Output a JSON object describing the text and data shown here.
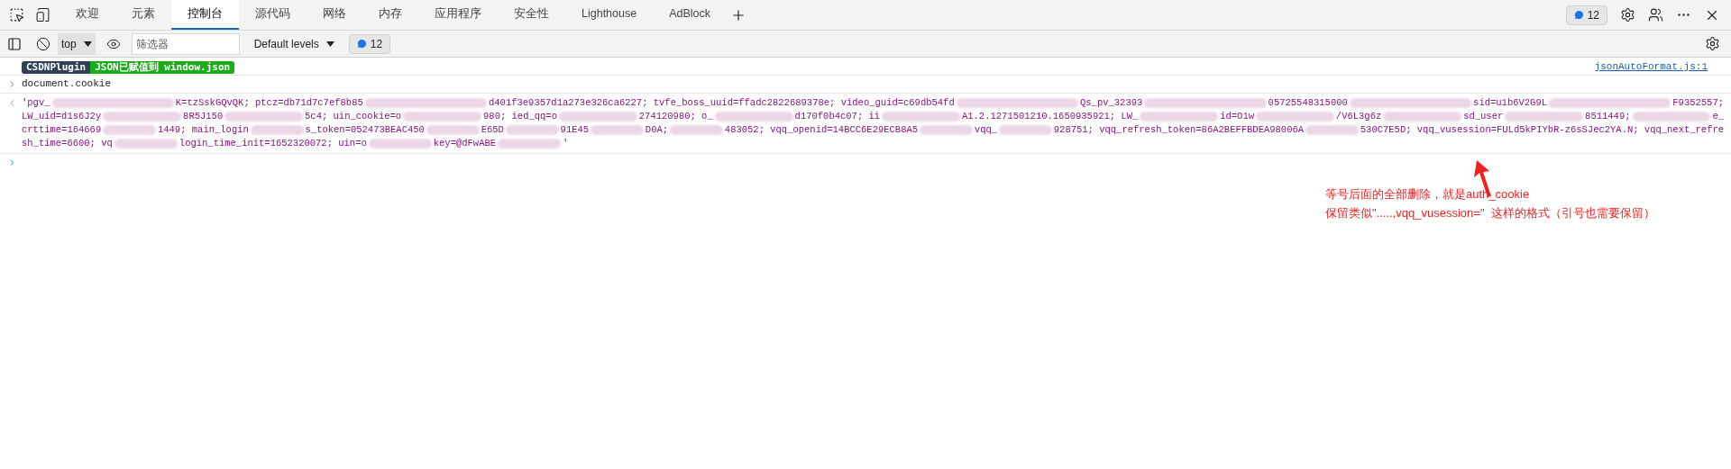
{
  "tabs": [
    {
      "label": "欢迎",
      "selected": false
    },
    {
      "label": "元素",
      "selected": false
    },
    {
      "label": "控制台",
      "selected": true
    },
    {
      "label": "源代码",
      "selected": false
    },
    {
      "label": "网络",
      "selected": false
    },
    {
      "label": "内存",
      "selected": false
    },
    {
      "label": "应用程序",
      "selected": false
    },
    {
      "label": "安全性",
      "selected": false
    },
    {
      "label": "Lighthouse",
      "selected": false
    },
    {
      "label": "AdBlock",
      "selected": false
    }
  ],
  "issues_badge": {
    "count": "12"
  },
  "toolbar": {
    "context": "top",
    "filter": {
      "placeholder": "筛选器"
    },
    "levels": "Default levels",
    "messages_badge": "12"
  },
  "log": {
    "badges": [
      {
        "text": "CSDNPlugin",
        "color": "#2f4058"
      },
      {
        "text": "JSON已赋值到 window.json",
        "color": "#1aac19"
      }
    ],
    "source": "jsonAutoFormat.js:1"
  },
  "input": {
    "text": "document.cookie"
  },
  "output": {
    "lines": [
      [
        {
          "kind": "text",
          "text": "'pgv_"
        },
        {
          "kind": "blur"
        },
        {
          "kind": "text",
          "text": "K=tzSskGQvQK; ptcz=db71d7c7ef8b85"
        },
        {
          "kind": "blur"
        },
        {
          "kind": "text",
          "text": "d401f3e9357d1a273e326ca6227; tvfe_boss_uuid=ffadc2822689378e; video_guid=c69db54fd"
        },
        {
          "kind": "blur"
        },
        {
          "kind": "text",
          "text": "Qs_pv_32393"
        },
        {
          "kind": "blur"
        },
        {
          "kind": "text",
          "text": "05725548315000"
        },
        {
          "kind": "blur"
        },
        {
          "kind": "text",
          "text": "sid=u1b6V2G9L"
        },
        {
          "kind": "blur"
        },
        {
          "kind": "text",
          "text": "F9352557;"
        }
      ],
      [
        {
          "kind": "text",
          "text": "LW_uid=d1s6J2y"
        },
        {
          "kind": "blur"
        },
        {
          "kind": "text",
          "text": "8R5J150"
        },
        {
          "kind": "blur"
        },
        {
          "kind": "text",
          "text": "5c4; uin_cookie=o"
        },
        {
          "kind": "blur"
        },
        {
          "kind": "text",
          "text": "980; ied_qq=o"
        },
        {
          "kind": "blur"
        },
        {
          "kind": "text",
          "text": "274120980; o_"
        },
        {
          "kind": "blur"
        },
        {
          "kind": "text",
          "text": "d170f0b4c07; ii"
        },
        {
          "kind": "blur"
        },
        {
          "kind": "text",
          "text": "A1.2.1271501210.1650935921; LW_"
        },
        {
          "kind": "blur"
        },
        {
          "kind": "text",
          "text": "id=O1w"
        },
        {
          "kind": "blur"
        },
        {
          "kind": "text",
          "text": "/V6L3g6z"
        },
        {
          "kind": "blur"
        },
        {
          "kind": "text",
          "text": "sd_user"
        },
        {
          "kind": "blur"
        },
        {
          "kind": "text",
          "text": "8511449;"
        },
        {
          "kind": "blur"
        },
        {
          "kind": "text",
          "text": "e_"
        }
      ],
      [
        {
          "kind": "text",
          "text": "crttime=164669"
        },
        {
          "kind": "blur"
        },
        {
          "kind": "text",
          "text": "1449; main_login"
        },
        {
          "kind": "blur"
        },
        {
          "kind": "text",
          "text": "s_token=052473BEAC450"
        },
        {
          "kind": "blur"
        },
        {
          "kind": "text",
          "text": "E65D"
        },
        {
          "kind": "blur"
        },
        {
          "kind": "text",
          "text": "91E45"
        },
        {
          "kind": "blur"
        },
        {
          "kind": "text",
          "text": "D0A;"
        },
        {
          "kind": "blur"
        },
        {
          "kind": "text",
          "text": "483052; vqq_openid=14BCC6E29ECB8A5"
        },
        {
          "kind": "blur"
        },
        {
          "kind": "text",
          "text": "vqq_"
        },
        {
          "kind": "blur"
        },
        {
          "kind": "text",
          "text": "928751; vqq_refresh_token=86A2BEFFBDEA98006A"
        },
        {
          "kind": "blur"
        },
        {
          "kind": "text",
          "text": "530C7E5D; vqq_vusession=FULd5kPIYbR-z6sSJec2YA.N; vqq_next_refre"
        }
      ],
      [
        {
          "kind": "text",
          "text": "sh_time=6600; vq"
        },
        {
          "kind": "blur"
        },
        {
          "kind": "text",
          "text": "login_time_init=1652320072; uin=o"
        },
        {
          "kind": "blur"
        },
        {
          "kind": "text",
          "text": "key=@dFwABE"
        },
        {
          "kind": "blur"
        },
        {
          "kind": "text",
          "text": "'"
        }
      ]
    ]
  },
  "annotation": {
    "lines": [
      "等号后面的全部删除，就是auth_cookie",
      "保留类似\".....,vqq_vusession=\"  这样的格式（引号也需要保留）"
    ]
  }
}
